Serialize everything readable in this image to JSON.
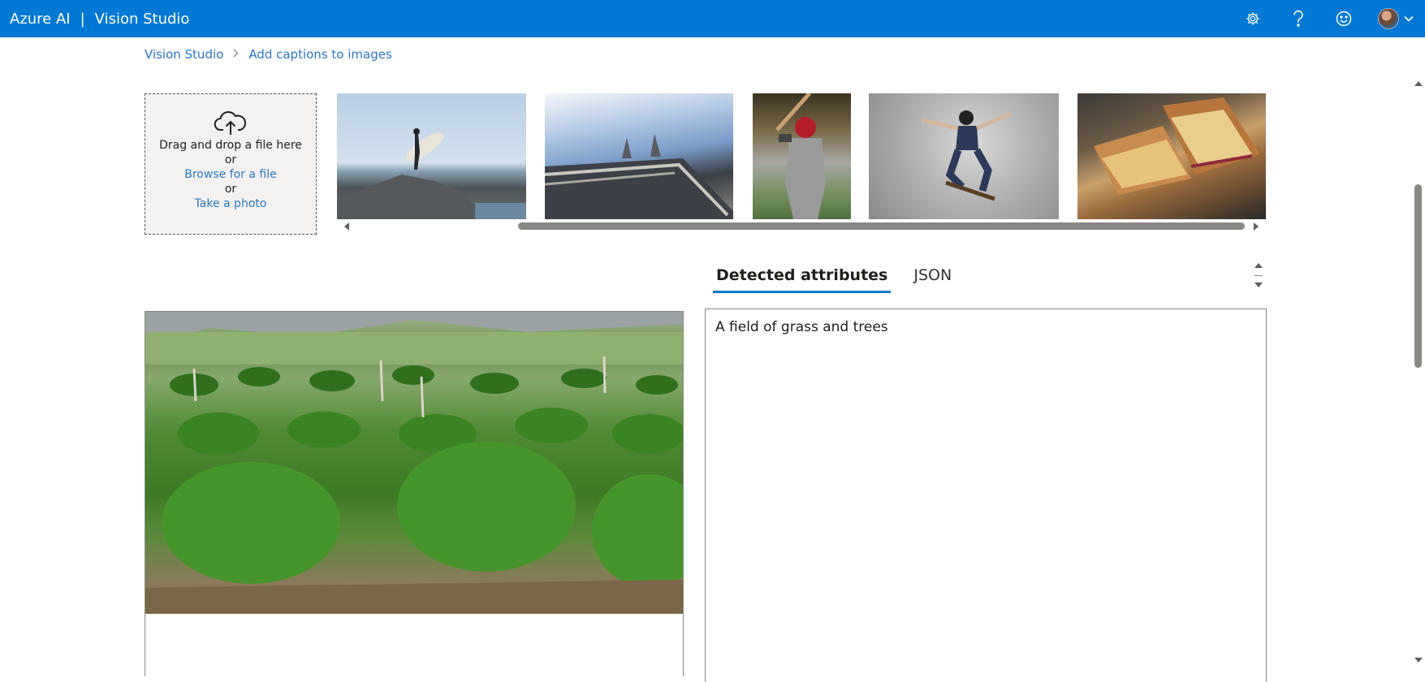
{
  "header": {
    "brand": "Azure AI",
    "separator": "|",
    "product": "Vision Studio",
    "icons": [
      "gear-icon",
      "help-icon",
      "feedback-smiley-icon",
      "avatar",
      "chevron-down-icon"
    ],
    "bar_color": "#0078d4"
  },
  "breadcrumb": {
    "items": [
      "Vision Studio",
      "Add captions to images"
    ]
  },
  "upload": {
    "line1": "Drag and drop a file here",
    "or1": "or",
    "browse": "Browse for a file",
    "or2": "or",
    "photo": "Take a photo"
  },
  "samples": [
    {
      "subject": "surfer on rocky cliff"
    },
    {
      "subject": "building facade with statues"
    },
    {
      "subject": "baseball batter"
    },
    {
      "subject": "skateboarder jumping"
    },
    {
      "subject": "grilled sandwich"
    }
  ],
  "tabs": {
    "detected": "Detected attributes",
    "json": "JSON",
    "active": "Detected attributes"
  },
  "results": {
    "caption": "A field of grass and trees"
  },
  "colors": {
    "accent": "#0078d4",
    "link": "#2b78c5"
  }
}
